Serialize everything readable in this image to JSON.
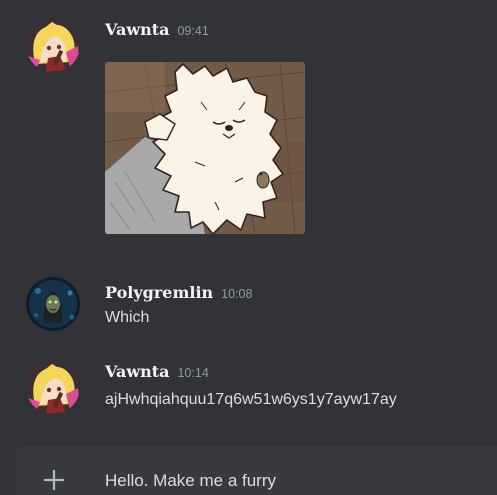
{
  "messages": [
    {
      "username": "Vawnta",
      "timestamp": "09:41",
      "avatar_icon": "anime-character-avatar"
    },
    {
      "username": "Polygremlin",
      "timestamp": "10:08",
      "text": "Which",
      "avatar_icon": "dark-creature-avatar"
    },
    {
      "username": "Vawnta",
      "timestamp": "10:14",
      "text": "ajHwhqiahquu17q6w51w6ys1y7ayw17ay",
      "avatar_icon": "anime-character-avatar"
    }
  ],
  "composer": {
    "value": "Hello. Make me a furry",
    "plus_icon": "plus-icon"
  }
}
